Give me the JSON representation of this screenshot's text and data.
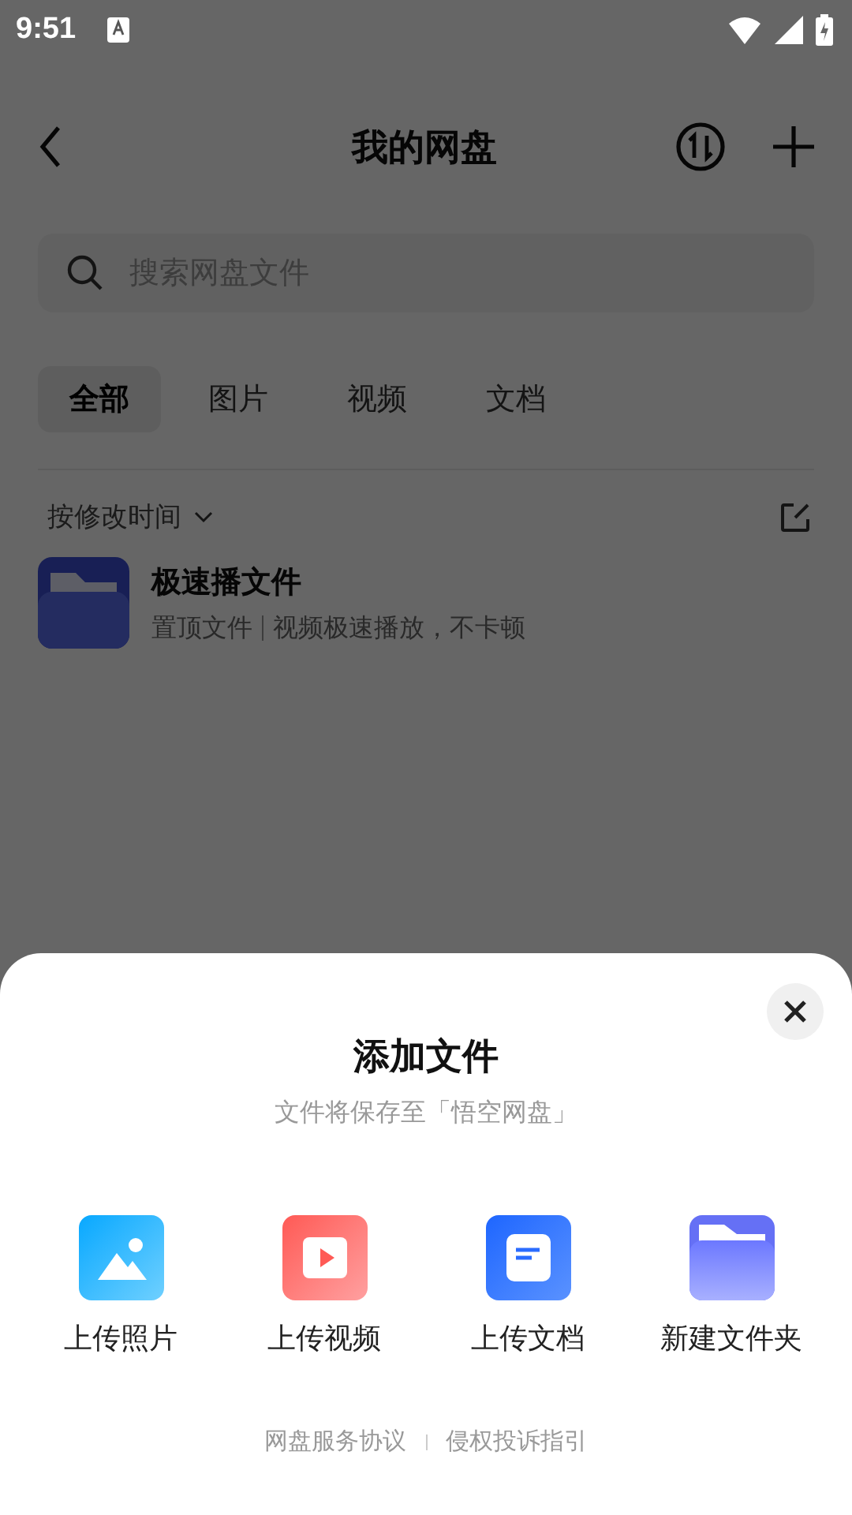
{
  "status_bar": {
    "time": "9:51"
  },
  "header": {
    "title": "我的网盘"
  },
  "search": {
    "placeholder": "搜索网盘文件"
  },
  "tabs": [
    {
      "label": "全部",
      "selected": true
    },
    {
      "label": "图片",
      "selected": false
    },
    {
      "label": "视频",
      "selected": false
    },
    {
      "label": "文档",
      "selected": false
    }
  ],
  "sort": {
    "label": "按修改时间"
  },
  "files": [
    {
      "name": "极速播文件",
      "tag": "置顶文件",
      "description": "视频极速播放，不卡顿"
    }
  ],
  "sheet": {
    "title": "添加文件",
    "subtitle": "文件将保存至「悟空网盘」",
    "actions": [
      {
        "kind": "photo",
        "label": "上传照片"
      },
      {
        "kind": "video",
        "label": "上传视频"
      },
      {
        "kind": "doc",
        "label": "上传文档"
      },
      {
        "kind": "folder",
        "label": "新建文件夹"
      }
    ],
    "links": [
      "网盘服务协议",
      "侵权投诉指引"
    ]
  }
}
